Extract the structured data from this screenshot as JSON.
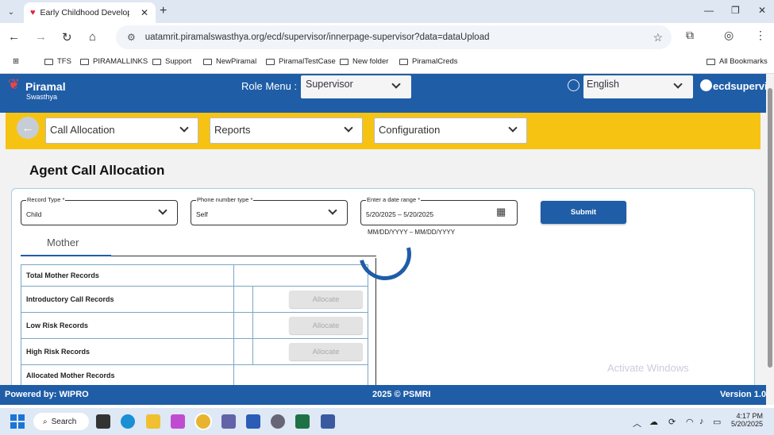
{
  "browser": {
    "tab_title": "Early Childhood Developmen",
    "url": "uatamrit.piramalswasthya.org/ecd/supervisor/innerpage-supervisor?data=dataUpload",
    "bookmarks": [
      "TFS",
      "PIRAMALLINKS",
      "Support",
      "NewPiramal",
      "PiramalTestCase",
      "New folder",
      "PiramalCreds"
    ],
    "all_bookmarks": "All Bookmarks"
  },
  "header": {
    "logo_name": "Piramal",
    "logo_sub": "Swasthya",
    "role_label": "Role Menu :",
    "role_value": "Supervisor",
    "language": "English",
    "username": "ecdsupervis"
  },
  "menu": {
    "call_allocation": "Call Allocation",
    "reports": "Reports",
    "configuration": "Configuration"
  },
  "page": {
    "title": "Agent Call Allocation"
  },
  "form": {
    "record_type_label": "Record Type *",
    "record_type_value": "Child",
    "phone_type_label": "Phone number type *",
    "phone_type_value": "Self",
    "date_label": "Enter a date range *",
    "date_value": "5/20/2025 – 5/20/2025",
    "date_hint": "MM/DD/YYYY – MM/DD/YYYY",
    "submit": "Submit"
  },
  "tabs": {
    "mother": "Mother"
  },
  "records": {
    "total": "Total Mother Records",
    "intro": "Introductory Call Records",
    "low": "Low Risk Records",
    "high": "High Risk Records",
    "allocated": "Allocated Mother Records",
    "allocate": "Allocate"
  },
  "watermark": "Activate Windows",
  "footer": {
    "powered": "Powered by: WIPRO",
    "copyright": "2025 © PSMRI",
    "version": "Version 1.0"
  },
  "taskbar": {
    "search": "Search",
    "time": "4:17 PM",
    "date": "5/20/2025"
  }
}
